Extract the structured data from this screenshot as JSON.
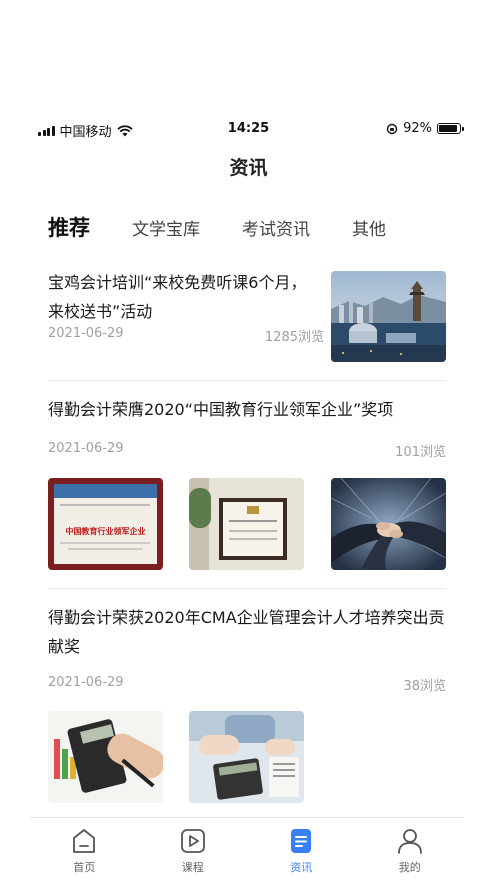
{
  "status_bar": {
    "carrier": "中国移动",
    "time": "14:25",
    "battery": "92%",
    "battery_level": 0.92
  },
  "header": {
    "title": "资讯"
  },
  "tabs": [
    {
      "label": "推荐",
      "active": true
    },
    {
      "label": "文学宝库",
      "active": false
    },
    {
      "label": "考试资讯",
      "active": false
    },
    {
      "label": "其他",
      "active": false
    }
  ],
  "articles": [
    {
      "title": "宝鸡会计培训“来校免费听课6个月，来校送书”活动",
      "date": "2021-06-29",
      "views": "1285浏览"
    },
    {
      "title": "得勤会计荣膺2020“中国教育行业领军企业”奖项",
      "date": "2021-06-29",
      "views": "101浏览",
      "certificate_text": "中国教育行业领军企业"
    },
    {
      "title": "得勤会计荣获2020年CMA企业管理会计人才培养突出贡献奖",
      "date": "2021-06-29",
      "views": "38浏览"
    }
  ],
  "tabbar": [
    {
      "label": "首页",
      "icon": "home-icon",
      "active": false
    },
    {
      "label": "课程",
      "icon": "play-icon",
      "active": false
    },
    {
      "label": "资讯",
      "icon": "news-icon",
      "active": true
    },
    {
      "label": "我的",
      "icon": "user-icon",
      "active": false
    }
  ],
  "colors": {
    "accent": "#3a80f5",
    "text": "#1a1a1a",
    "meta": "#a0a0a0"
  }
}
